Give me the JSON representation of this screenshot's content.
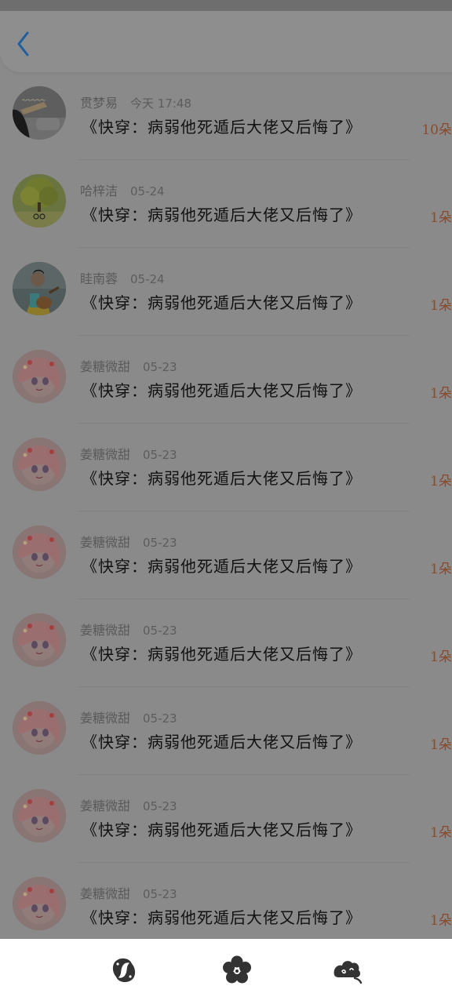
{
  "header": {
    "back_icon": "chevron-left-icon"
  },
  "items": [
    {
      "user": "贯梦易",
      "time": "今天 17:48",
      "title": "《快穿：病弱他死遁后大佬又后悔了》",
      "count": "10朵",
      "avatar": "photo-guitar-girl"
    },
    {
      "user": "哈梓洁",
      "time": "05-24",
      "title": "《快穿：病弱他死遁后大佬又后悔了》",
      "count": "1朵",
      "avatar": "photo-tree"
    },
    {
      "user": "眭南蓉",
      "time": "05-24",
      "title": "《快穿：病弱他死遁后大佬又后悔了》",
      "count": "1朵",
      "avatar": "photo-guitar-boy"
    },
    {
      "user": "姜糖微甜",
      "time": "05-23",
      "title": "《快穿：病弱他死遁后大佬又后悔了》",
      "count": "1朵",
      "avatar": "anime-girl"
    },
    {
      "user": "姜糖微甜",
      "time": "05-23",
      "title": "《快穿：病弱他死遁后大佬又后悔了》",
      "count": "1朵",
      "avatar": "anime-girl"
    },
    {
      "user": "姜糖微甜",
      "time": "05-23",
      "title": "《快穿：病弱他死遁后大佬又后悔了》",
      "count": "1朵",
      "avatar": "anime-girl"
    },
    {
      "user": "姜糖微甜",
      "time": "05-23",
      "title": "《快穿：病弱他死遁后大佬又后悔了》",
      "count": "1朵",
      "avatar": "anime-girl"
    },
    {
      "user": "姜糖微甜",
      "time": "05-23",
      "title": "《快穿：病弱他死遁后大佬又后悔了》",
      "count": "1朵",
      "avatar": "anime-girl"
    },
    {
      "user": "姜糖微甜",
      "time": "05-23",
      "title": "《快穿：病弱他死遁后大佬又后悔了》",
      "count": "1朵",
      "avatar": "anime-girl"
    },
    {
      "user": "姜糖微甜",
      "time": "05-23",
      "title": "《快穿：病弱他死遁后大佬又后悔了》",
      "count": "1朵",
      "avatar": "anime-girl"
    }
  ],
  "tabbar": {
    "tabs": [
      "koi-fish-icon",
      "plum-blossom-icon",
      "auspicious-cloud-icon"
    ]
  },
  "colors": {
    "accent": "#2f7fd0",
    "count": "#e0672d",
    "overlay": "#8a8a8a"
  }
}
